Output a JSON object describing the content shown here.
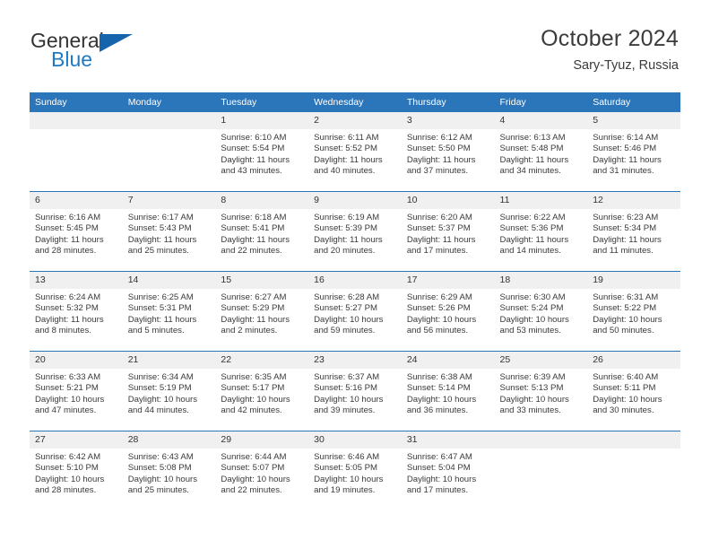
{
  "brand": {
    "name_part1": "General",
    "name_part2": "Blue",
    "triangle_icon": "triangle-icon",
    "color_primary": "#1664ab",
    "color_secondary": "#1f7ac4"
  },
  "header": {
    "title": "October 2024",
    "subtitle": "Sary-Tyuz, Russia"
  },
  "calendar": {
    "accent_color": "#2b76ba",
    "daynum_bg": "#f0f0f0",
    "weekday_headers": [
      "Sunday",
      "Monday",
      "Tuesday",
      "Wednesday",
      "Thursday",
      "Friday",
      "Saturday"
    ],
    "weeks": [
      [
        {
          "day": "",
          "sunrise": "",
          "sunset": "",
          "daylight1": "",
          "daylight2": ""
        },
        {
          "day": "",
          "sunrise": "",
          "sunset": "",
          "daylight1": "",
          "daylight2": ""
        },
        {
          "day": "1",
          "sunrise": "Sunrise: 6:10 AM",
          "sunset": "Sunset: 5:54 PM",
          "daylight1": "Daylight: 11 hours",
          "daylight2": "and 43 minutes."
        },
        {
          "day": "2",
          "sunrise": "Sunrise: 6:11 AM",
          "sunset": "Sunset: 5:52 PM",
          "daylight1": "Daylight: 11 hours",
          "daylight2": "and 40 minutes."
        },
        {
          "day": "3",
          "sunrise": "Sunrise: 6:12 AM",
          "sunset": "Sunset: 5:50 PM",
          "daylight1": "Daylight: 11 hours",
          "daylight2": "and 37 minutes."
        },
        {
          "day": "4",
          "sunrise": "Sunrise: 6:13 AM",
          "sunset": "Sunset: 5:48 PM",
          "daylight1": "Daylight: 11 hours",
          "daylight2": "and 34 minutes."
        },
        {
          "day": "5",
          "sunrise": "Sunrise: 6:14 AM",
          "sunset": "Sunset: 5:46 PM",
          "daylight1": "Daylight: 11 hours",
          "daylight2": "and 31 minutes."
        }
      ],
      [
        {
          "day": "6",
          "sunrise": "Sunrise: 6:16 AM",
          "sunset": "Sunset: 5:45 PM",
          "daylight1": "Daylight: 11 hours",
          "daylight2": "and 28 minutes."
        },
        {
          "day": "7",
          "sunrise": "Sunrise: 6:17 AM",
          "sunset": "Sunset: 5:43 PM",
          "daylight1": "Daylight: 11 hours",
          "daylight2": "and 25 minutes."
        },
        {
          "day": "8",
          "sunrise": "Sunrise: 6:18 AM",
          "sunset": "Sunset: 5:41 PM",
          "daylight1": "Daylight: 11 hours",
          "daylight2": "and 22 minutes."
        },
        {
          "day": "9",
          "sunrise": "Sunrise: 6:19 AM",
          "sunset": "Sunset: 5:39 PM",
          "daylight1": "Daylight: 11 hours",
          "daylight2": "and 20 minutes."
        },
        {
          "day": "10",
          "sunrise": "Sunrise: 6:20 AM",
          "sunset": "Sunset: 5:37 PM",
          "daylight1": "Daylight: 11 hours",
          "daylight2": "and 17 minutes."
        },
        {
          "day": "11",
          "sunrise": "Sunrise: 6:22 AM",
          "sunset": "Sunset: 5:36 PM",
          "daylight1": "Daylight: 11 hours",
          "daylight2": "and 14 minutes."
        },
        {
          "day": "12",
          "sunrise": "Sunrise: 6:23 AM",
          "sunset": "Sunset: 5:34 PM",
          "daylight1": "Daylight: 11 hours",
          "daylight2": "and 11 minutes."
        }
      ],
      [
        {
          "day": "13",
          "sunrise": "Sunrise: 6:24 AM",
          "sunset": "Sunset: 5:32 PM",
          "daylight1": "Daylight: 11 hours",
          "daylight2": "and 8 minutes."
        },
        {
          "day": "14",
          "sunrise": "Sunrise: 6:25 AM",
          "sunset": "Sunset: 5:31 PM",
          "daylight1": "Daylight: 11 hours",
          "daylight2": "and 5 minutes."
        },
        {
          "day": "15",
          "sunrise": "Sunrise: 6:27 AM",
          "sunset": "Sunset: 5:29 PM",
          "daylight1": "Daylight: 11 hours",
          "daylight2": "and 2 minutes."
        },
        {
          "day": "16",
          "sunrise": "Sunrise: 6:28 AM",
          "sunset": "Sunset: 5:27 PM",
          "daylight1": "Daylight: 10 hours",
          "daylight2": "and 59 minutes."
        },
        {
          "day": "17",
          "sunrise": "Sunrise: 6:29 AM",
          "sunset": "Sunset: 5:26 PM",
          "daylight1": "Daylight: 10 hours",
          "daylight2": "and 56 minutes."
        },
        {
          "day": "18",
          "sunrise": "Sunrise: 6:30 AM",
          "sunset": "Sunset: 5:24 PM",
          "daylight1": "Daylight: 10 hours",
          "daylight2": "and 53 minutes."
        },
        {
          "day": "19",
          "sunrise": "Sunrise: 6:31 AM",
          "sunset": "Sunset: 5:22 PM",
          "daylight1": "Daylight: 10 hours",
          "daylight2": "and 50 minutes."
        }
      ],
      [
        {
          "day": "20",
          "sunrise": "Sunrise: 6:33 AM",
          "sunset": "Sunset: 5:21 PM",
          "daylight1": "Daylight: 10 hours",
          "daylight2": "and 47 minutes."
        },
        {
          "day": "21",
          "sunrise": "Sunrise: 6:34 AM",
          "sunset": "Sunset: 5:19 PM",
          "daylight1": "Daylight: 10 hours",
          "daylight2": "and 44 minutes."
        },
        {
          "day": "22",
          "sunrise": "Sunrise: 6:35 AM",
          "sunset": "Sunset: 5:17 PM",
          "daylight1": "Daylight: 10 hours",
          "daylight2": "and 42 minutes."
        },
        {
          "day": "23",
          "sunrise": "Sunrise: 6:37 AM",
          "sunset": "Sunset: 5:16 PM",
          "daylight1": "Daylight: 10 hours",
          "daylight2": "and 39 minutes."
        },
        {
          "day": "24",
          "sunrise": "Sunrise: 6:38 AM",
          "sunset": "Sunset: 5:14 PM",
          "daylight1": "Daylight: 10 hours",
          "daylight2": "and 36 minutes."
        },
        {
          "day": "25",
          "sunrise": "Sunrise: 6:39 AM",
          "sunset": "Sunset: 5:13 PM",
          "daylight1": "Daylight: 10 hours",
          "daylight2": "and 33 minutes."
        },
        {
          "day": "26",
          "sunrise": "Sunrise: 6:40 AM",
          "sunset": "Sunset: 5:11 PM",
          "daylight1": "Daylight: 10 hours",
          "daylight2": "and 30 minutes."
        }
      ],
      [
        {
          "day": "27",
          "sunrise": "Sunrise: 6:42 AM",
          "sunset": "Sunset: 5:10 PM",
          "daylight1": "Daylight: 10 hours",
          "daylight2": "and 28 minutes."
        },
        {
          "day": "28",
          "sunrise": "Sunrise: 6:43 AM",
          "sunset": "Sunset: 5:08 PM",
          "daylight1": "Daylight: 10 hours",
          "daylight2": "and 25 minutes."
        },
        {
          "day": "29",
          "sunrise": "Sunrise: 6:44 AM",
          "sunset": "Sunset: 5:07 PM",
          "daylight1": "Daylight: 10 hours",
          "daylight2": "and 22 minutes."
        },
        {
          "day": "30",
          "sunrise": "Sunrise: 6:46 AM",
          "sunset": "Sunset: 5:05 PM",
          "daylight1": "Daylight: 10 hours",
          "daylight2": "and 19 minutes."
        },
        {
          "day": "31",
          "sunrise": "Sunrise: 6:47 AM",
          "sunset": "Sunset: 5:04 PM",
          "daylight1": "Daylight: 10 hours",
          "daylight2": "and 17 minutes."
        },
        {
          "day": "",
          "sunrise": "",
          "sunset": "",
          "daylight1": "",
          "daylight2": ""
        },
        {
          "day": "",
          "sunrise": "",
          "sunset": "",
          "daylight1": "",
          "daylight2": ""
        }
      ]
    ]
  }
}
